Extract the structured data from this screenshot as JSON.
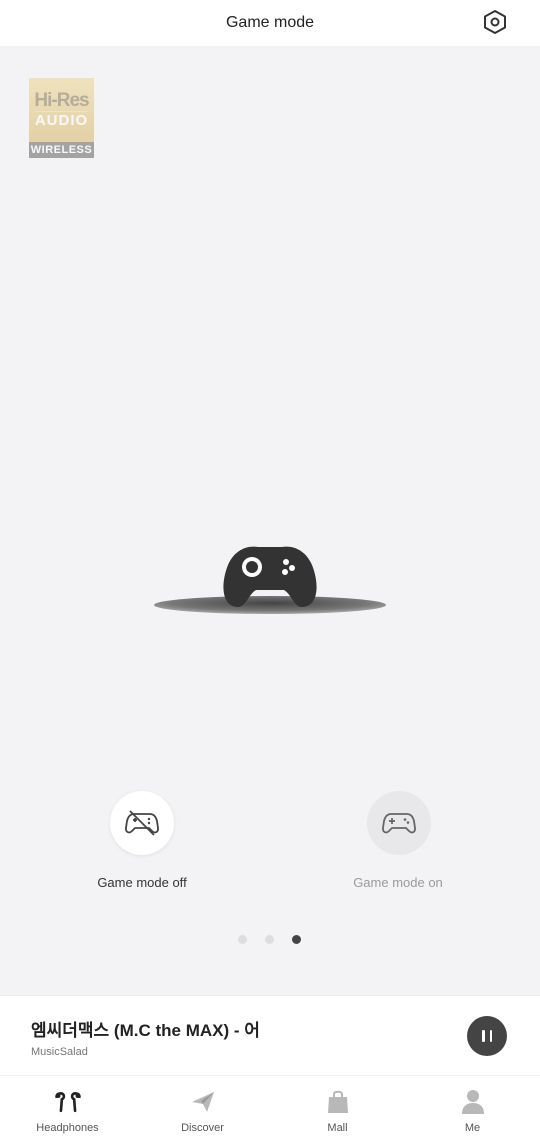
{
  "header": {
    "title": "Game mode"
  },
  "badge": {
    "line1": "Hi-Res",
    "line2": "AUDIO",
    "line3": "WIRELESS"
  },
  "modes": {
    "off_label": "Game mode off",
    "on_label": "Game mode on",
    "selected": "off"
  },
  "pager": {
    "count": 3,
    "active_index": 3
  },
  "player": {
    "title": "엠씨더맥스 (M.C the MAX) - 어",
    "artist": "MusicSalad",
    "state": "playing"
  },
  "nav": {
    "items": [
      {
        "label": "Headphones",
        "icon": "earbuds-icon"
      },
      {
        "label": "Discover",
        "icon": "paper-plane-icon"
      },
      {
        "label": "Mall",
        "icon": "shopping-bag-icon"
      },
      {
        "label": "Me",
        "icon": "person-icon"
      }
    ]
  },
  "colors": {
    "active_dot": "#444444",
    "inactive_dot": "#dedee0",
    "background": "#f3f3f5"
  }
}
